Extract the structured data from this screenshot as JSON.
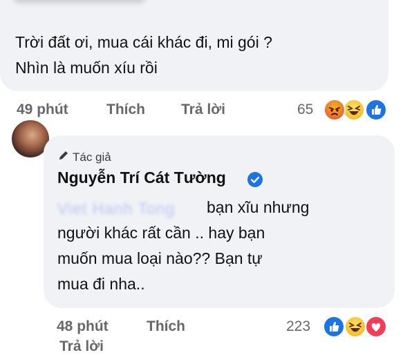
{
  "comment1": {
    "text_line1": "Trời đất ơi,  mua cái khác đi,  mi gói  ?",
    "text_line2": "Nhìn là muốn xíu rồi",
    "time": "49 phút",
    "like_label": "Thích",
    "reply_label": "Trả lời",
    "reaction_count": "65",
    "reactions": [
      "angry-icon",
      "haha-icon",
      "like-icon"
    ]
  },
  "reply": {
    "author_badge": "Tác giả",
    "author_name": "Nguyễn Trí Cát Tường",
    "mention": "Viet Hanh Tong",
    "text_line1": "bạn xĩu nhưng",
    "text_line2": "người khác rất cần .. hay bạn",
    "text_line3": "muốn mua loại nào?? Bạn tự",
    "text_line4": "mua đi nha..",
    "time": "48 phút",
    "like_label": "Thích",
    "reply_label": "Trả lời",
    "reaction_count": "223",
    "reactions": [
      "like-icon",
      "haha-icon",
      "love-icon"
    ]
  },
  "colors": {
    "bubble": "#f0f2f5",
    "meta": "#65676b",
    "verified": "#1b74e4"
  }
}
